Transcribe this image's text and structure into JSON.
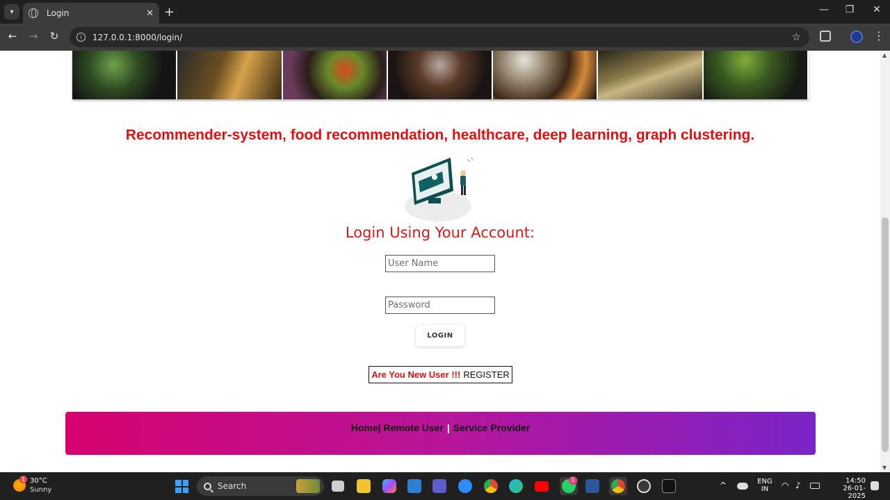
{
  "browser": {
    "tab_title": "Login",
    "url": "127.0.0.1:8000/login/"
  },
  "page": {
    "headline": "Recommender-system, food recommendation, healthcare, deep learning, graph clustering.",
    "login_title": "Login Using Your Account:",
    "username_placeholder": "User Name",
    "password_placeholder": "Password",
    "login_button": "LOGIN",
    "new_user_question": "Are You New User !!!",
    "register_link": "REGISTER",
    "footer": {
      "home": "Home",
      "remote_user": "Remote User",
      "service_provider": "Service Provider"
    }
  },
  "taskbar": {
    "weather_temp": "30°C",
    "weather_condition": "Sunny",
    "weather_badge": "1",
    "search_label": "Search",
    "whatsapp_badge": "1",
    "lang_primary": "ENG",
    "lang_region": "IN",
    "time": "14:50",
    "date": "26-01-2025"
  }
}
